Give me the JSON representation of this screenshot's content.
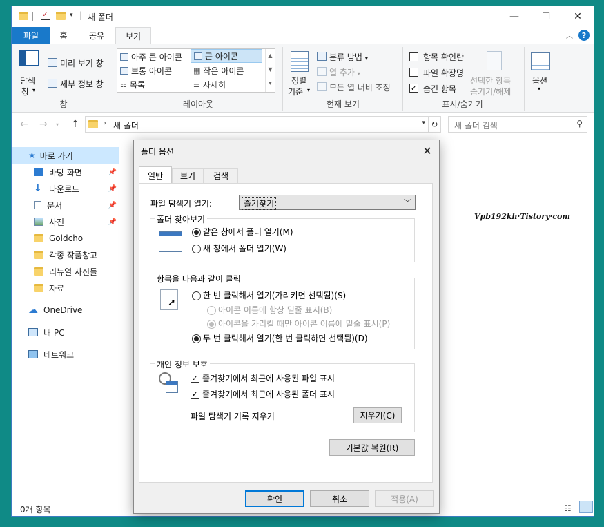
{
  "window": {
    "title": "새 폴더",
    "controls": {
      "minimize": "—",
      "maximize": "☐",
      "close": "✕"
    }
  },
  "ribbon_tabs": [
    "파일",
    "홈",
    "공유",
    "보기"
  ],
  "ribbon": {
    "panes": {
      "nav_pane_label": "탐색\n창",
      "nav_pane_line1": "탐색",
      "nav_pane_line2": "창",
      "preview": "미리 보기 창",
      "details": "세부 정보 창",
      "group": "창"
    },
    "layout": {
      "items": [
        "아주 큰 아이콘",
        "큰 아이콘",
        "보통 아이콘",
        "작은 아이콘",
        "목록",
        "자세히"
      ],
      "selected": "큰 아이콘",
      "group": "레이아웃"
    },
    "current_view": {
      "sort_line1": "정렬",
      "sort_line2": "기준",
      "group_by": "분류 방법",
      "add_columns": "열 추가",
      "size_all_columns": "모든 열 너비 조정",
      "group": "현재 보기"
    },
    "show_hide": {
      "item_checkboxes": "항목 확인란",
      "file_extensions": "파일 확장명",
      "hidden_items": "숨긴 항목",
      "hide_selected_line1": "선택한 항목",
      "hide_selected_line2": "숨기기/해제",
      "group": "표시/숨기기",
      "item_checkboxes_checked": false,
      "file_extensions_checked": false,
      "hidden_items_checked": true
    },
    "options": {
      "label": "옵션"
    }
  },
  "address": {
    "path": "새 폴더",
    "search_placeholder": "새 폴더 검색"
  },
  "nav_pane": {
    "quick_access": "바로 가기",
    "items": [
      {
        "label": "바탕 화면",
        "pinned": true
      },
      {
        "label": "다운로드",
        "pinned": true
      },
      {
        "label": "문서",
        "pinned": true
      },
      {
        "label": "사진",
        "pinned": true
      },
      {
        "label": "Goldcho",
        "pinned": false
      },
      {
        "label": "각종 작품창고",
        "pinned": false
      },
      {
        "label": "리뉴얼 사진들",
        "pinned": false
      },
      {
        "label": "자료",
        "pinned": false
      }
    ],
    "onedrive": "OneDrive",
    "this_pc": "내 PC",
    "network": "네트워크"
  },
  "watermark": "Vpb192kh·Tistory·com",
  "status_bar": "0개 항목",
  "dialog": {
    "title": "폴더 옵션",
    "tabs": [
      "일반",
      "보기",
      "검색"
    ],
    "open_explorer_label": "파일 탐색기 열기:",
    "open_explorer_value": "즐겨찾기",
    "browse_folders": {
      "legend": "폴더 찾아보기",
      "same_window": "같은 창에서 폴더 열기(M)",
      "new_window": "새 창에서 폴더 열기(W)",
      "selected": "same_window"
    },
    "click_items": {
      "legend": "항목을 다음과 같이 클릭",
      "single_click": "한 번 클릭해서 열기(가리키면 선택됨)(S)",
      "underline_always": "아이콘 이름에 항상 밑줄 표시(B)",
      "underline_hover": "아이콘을 가리킬 때만 아이콘 이름에 밑줄 표시(P)",
      "double_click": "두 번 클릭해서 열기(한 번 클릭하면 선택됨)(D)",
      "selected": "double_click"
    },
    "privacy": {
      "legend": "개인 정보 보호",
      "recent_files": "즐겨찾기에서 최근에 사용된 파일 표시",
      "frequent_folders": "즐겨찾기에서 최근에 사용된 폴더 표시",
      "clear_history_label": "파일 탐색기 기록 지우기",
      "clear_button": "지우기(C)",
      "recent_files_checked": true,
      "frequent_folders_checked": true
    },
    "restore_defaults": "기본값 복원(R)",
    "ok": "확인",
    "cancel": "취소",
    "apply": "적용(A)"
  }
}
